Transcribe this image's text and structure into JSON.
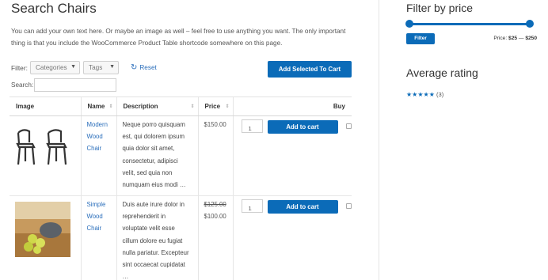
{
  "page": {
    "title": "Search Chairs",
    "intro": "You can add your own text here. Or maybe an image as well – feel free to use anything you want. The only important thing is that you include the WooCommerce Product Table shortcode somewhere on this page."
  },
  "filters": {
    "label": "Filter:",
    "categories": "Categories",
    "tags": "Tags",
    "reset": "Reset",
    "add_selected": "Add Selected To Cart",
    "search_label": "Search:",
    "search_value": ""
  },
  "table": {
    "headers": {
      "image": "Image",
      "name": "Name",
      "description": "Description",
      "price": "Price",
      "buy": "Buy"
    },
    "rows": [
      {
        "name": "Modern Wood Chair",
        "description": "Neque porro quisquam est, qui dolorem ipsum quia dolor sit amet, consectetur, adipisci velit, sed quia non numquam eius modi …",
        "price": "$150.00",
        "old_price": "",
        "qty": "1",
        "add_label": "Add to cart"
      },
      {
        "name": "Simple Wood Chair",
        "description": "Duis aute irure dolor in reprehenderit in voluptate velit esse cillum dolore eu fugiat nulla pariatur. Excepteur sint occaecat cupidatat …",
        "price": "$100.00",
        "old_price": "$125.00",
        "qty": "1",
        "add_label": "Add to cart"
      }
    ]
  },
  "sidebar": {
    "price_title": "Filter by price",
    "filter_button": "Filter",
    "price_label": "Price:",
    "price_min": "$25",
    "price_sep": "—",
    "price_max": "$250",
    "rating_title": "Average rating",
    "rating_stars": "★★★★★",
    "rating_count": "(3)"
  },
  "colors": {
    "accent": "#0b6bb8",
    "link": "#2a6ebb"
  }
}
